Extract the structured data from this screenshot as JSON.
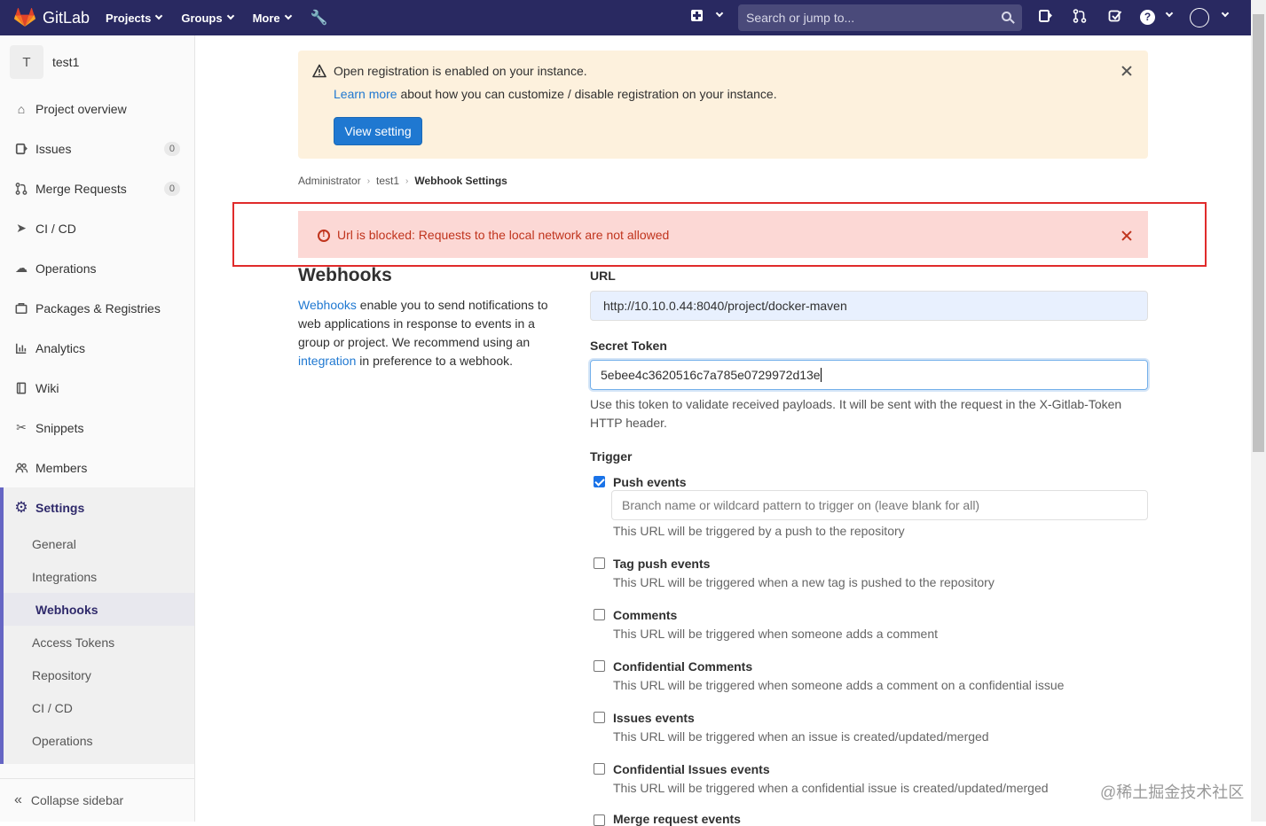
{
  "navbar": {
    "brand": "GitLab",
    "menu": [
      "Projects",
      "Groups",
      "More"
    ],
    "search_placeholder": "Search or jump to...",
    "bg_color": "#292961"
  },
  "sidebar": {
    "project_initial": "T",
    "project_name": "test1",
    "items": [
      {
        "label": "Project overview",
        "icon": "home-icon"
      },
      {
        "label": "Issues",
        "icon": "issues-icon",
        "badge": "0"
      },
      {
        "label": "Merge Requests",
        "icon": "merge-request-icon",
        "badge": "0"
      },
      {
        "label": "CI / CD",
        "icon": "rocket-icon"
      },
      {
        "label": "Operations",
        "icon": "cloud-gear-icon"
      },
      {
        "label": "Packages & Registries",
        "icon": "package-icon"
      },
      {
        "label": "Analytics",
        "icon": "chart-icon"
      },
      {
        "label": "Wiki",
        "icon": "book-icon"
      },
      {
        "label": "Snippets",
        "icon": "scissors-icon"
      },
      {
        "label": "Members",
        "icon": "users-icon"
      }
    ],
    "settings_label": "Settings",
    "settings_sub": [
      "General",
      "Integrations",
      "Webhooks",
      "Access Tokens",
      "Repository",
      "CI / CD",
      "Operations"
    ],
    "active_sub": "Webhooks",
    "collapse_label": "Collapse sidebar"
  },
  "warning_alert": {
    "title": "Open registration is enabled on your instance.",
    "link_text": "Learn more",
    "body_text": " about how you can customize / disable registration on your instance.",
    "button": "View setting"
  },
  "breadcrumb": [
    "Administrator",
    "test1",
    "Webhook Settings"
  ],
  "error_alert": {
    "text": "Url is blocked: Requests to the local network are not allowed",
    "color": "#c0341d"
  },
  "webhooks": {
    "title": "Webhooks",
    "desc_link1": "Webhooks",
    "desc_part1": " enable you to send notifications to web applications in response to events in a group or project. We recommend using an ",
    "desc_link2": "integration",
    "desc_part2": " in preference to a webhook."
  },
  "form": {
    "url_label": "URL",
    "url_value": "http://10.10.0.44:8040/project/docker-maven",
    "token_label": "Secret Token",
    "token_value": "5ebee4c3620516c7a785e0729972d13e",
    "token_help": "Use this token to validate received payloads. It will be sent with the request in the X-Gitlab-Token HTTP header.",
    "trigger_label": "Trigger",
    "branch_placeholder": "Branch name or wildcard pattern to trigger on (leave blank for all)",
    "triggers": [
      {
        "label": "Push events",
        "help": "This URL will be triggered by a push to the repository",
        "checked": true
      },
      {
        "label": "Tag push events",
        "help": "This URL will be triggered when a new tag is pushed to the repository",
        "checked": false
      },
      {
        "label": "Comments",
        "help": "This URL will be triggered when someone adds a comment",
        "checked": false
      },
      {
        "label": "Confidential Comments",
        "help": "This URL will be triggered when someone adds a comment on a confidential issue",
        "checked": false
      },
      {
        "label": "Issues events",
        "help": "This URL will be triggered when an issue is created/updated/merged",
        "checked": false
      },
      {
        "label": "Confidential Issues events",
        "help": "This URL will be triggered when a confidential issue is created/updated/merged",
        "checked": false
      },
      {
        "label": "Merge request events",
        "help": "",
        "checked": false
      }
    ]
  },
  "watermark": "@稀土掘金技术社区"
}
